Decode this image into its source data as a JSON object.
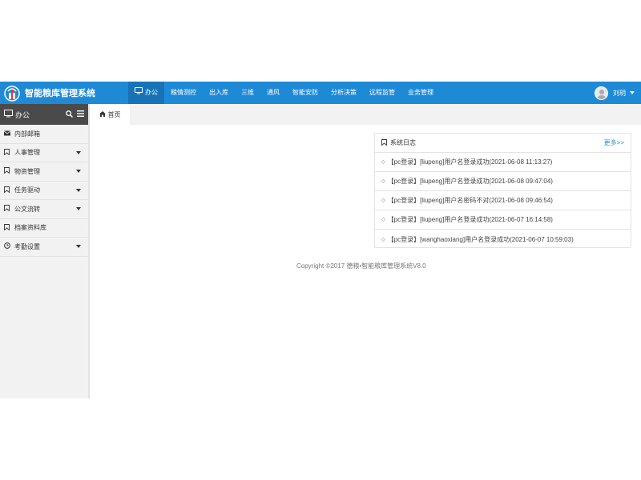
{
  "header": {
    "app_title": "智能粮库管理系统",
    "logo_icon": "logo-icon",
    "nav": [
      {
        "label": "办公",
        "icon": "monitor-icon",
        "active": true
      },
      {
        "label": "粮情测控"
      },
      {
        "label": "出入库"
      },
      {
        "label": "三维"
      },
      {
        "label": "通风"
      },
      {
        "label": "智能安防"
      },
      {
        "label": "分析决策"
      },
      {
        "label": "远程监管"
      },
      {
        "label": "业务管理"
      }
    ],
    "user_name": "刘玥",
    "accent_color": "#1e8ad6"
  },
  "sidebar": {
    "title": "办公",
    "items": [
      {
        "label": "内部邮箱",
        "icon": "envelope-icon",
        "has_dropdown": false
      },
      {
        "label": "人事管理",
        "icon": "bookmark-icon",
        "has_dropdown": true
      },
      {
        "label": "物资管理",
        "icon": "bookmark-icon",
        "has_dropdown": true
      },
      {
        "label": "任务驱动",
        "icon": "bookmark-icon",
        "has_dropdown": true
      },
      {
        "label": "公文流转",
        "icon": "bookmark-icon",
        "has_dropdown": true
      },
      {
        "label": "档案资料库",
        "icon": "bookmark-icon",
        "has_dropdown": false
      },
      {
        "label": "考勤设置",
        "icon": "clock-icon",
        "has_dropdown": true
      }
    ]
  },
  "tabs": [
    {
      "label": "首页",
      "icon": "home-icon"
    }
  ],
  "log_panel": {
    "title": "系统日志",
    "more_label": "更多>>",
    "entries": [
      "【pc登录】[liupeng]用户名登录成功(2021-06-08 11:13:27)",
      "【pc登录】[liupeng]用户名登录成功(2021-06-08 09:47:04)",
      "【pc登录】[liupeng]用户名密码不对(2021-06-08 09:46:54)",
      "【pc登录】[liupeng]用户名登录成功(2021-06-07 16:14:58)",
      "【pc登录】[wanghaoxiang]用户名登录成功(2021-06-07 10:59:03)"
    ]
  },
  "footer": {
    "copyright": "Copyright ©2017 德粮•智能粮库管理系统V8.0"
  }
}
